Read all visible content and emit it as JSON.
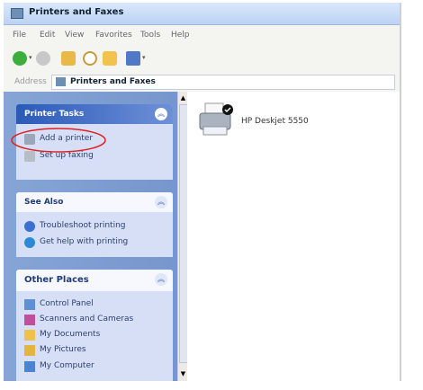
{
  "window": {
    "title": "Printers and Faxes"
  },
  "menubar": {
    "items": [
      "File",
      "Edit",
      "View",
      "Favorites",
      "Tools",
      "Help"
    ]
  },
  "address": {
    "label": "Address",
    "value": "Printers and Faxes"
  },
  "panels": {
    "printer_tasks": {
      "title": "Printer Tasks",
      "items": [
        "Add a printer",
        "Set up faxing"
      ]
    },
    "see_also": {
      "title": "See Also",
      "items": [
        "Troubleshoot printing",
        "Get help with printing"
      ]
    },
    "other_places": {
      "title": "Other Places",
      "items": [
        "Control Panel",
        "Scanners and Cameras",
        "My Documents",
        "My Pictures",
        "My Computer"
      ]
    }
  },
  "printers": [
    {
      "name": "HP Deskjet 5550"
    }
  ],
  "colors": {
    "accent": "#e02020",
    "pane": "#7c9bd0",
    "title": "#cfe0f8"
  }
}
